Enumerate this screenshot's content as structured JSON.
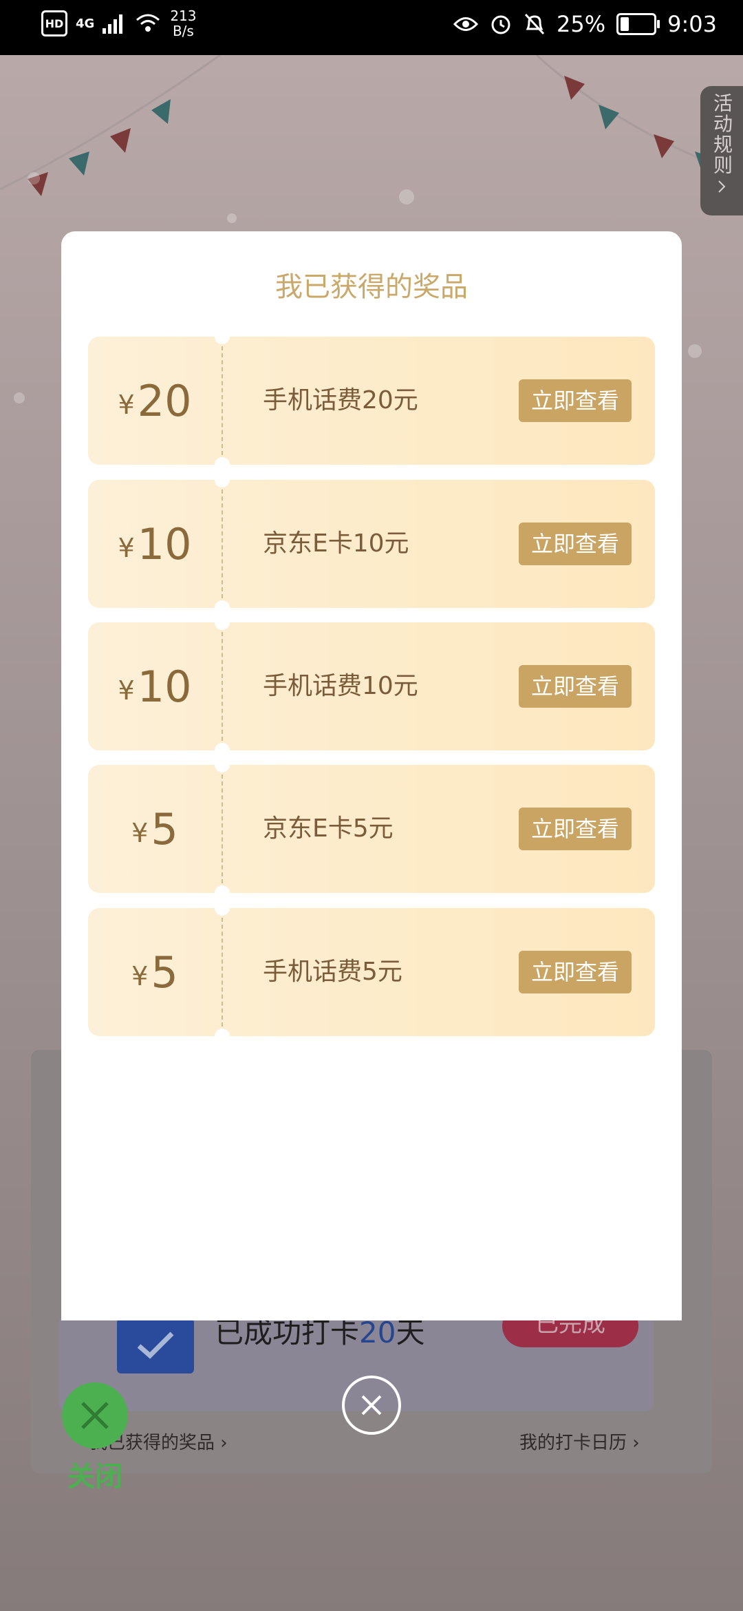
{
  "status_bar": {
    "hd_badge": "HD",
    "network": "4G",
    "speed_value": "213",
    "speed_unit": "B/s",
    "battery_percent": "25%",
    "time": "9:03"
  },
  "background": {
    "rules_tab": "活动规则",
    "checkin_prefix": "已成功打卡",
    "checkin_days": "20",
    "checkin_suffix": "天",
    "done_button": "已完成",
    "my_prizes_link": "我已获得的奖品",
    "calendar_link": "我的打卡日历",
    "close_label": "关闭"
  },
  "modal": {
    "title": "我已获得的奖品",
    "currency": "¥",
    "view_label": "立即查看",
    "prizes": [
      {
        "amount": "20",
        "name": "手机话费20元"
      },
      {
        "amount": "10",
        "name": "京东E卡10元"
      },
      {
        "amount": "10",
        "name": "手机话费10元"
      },
      {
        "amount": "5",
        "name": "京东E卡5元"
      },
      {
        "amount": "5",
        "name": "手机话费5元"
      }
    ]
  },
  "colors": {
    "accent_gold": "#c9a463",
    "title_gold": "#c9a86a",
    "card_bg": "#fdebc8",
    "checkin_days_blue": "#25458f"
  }
}
